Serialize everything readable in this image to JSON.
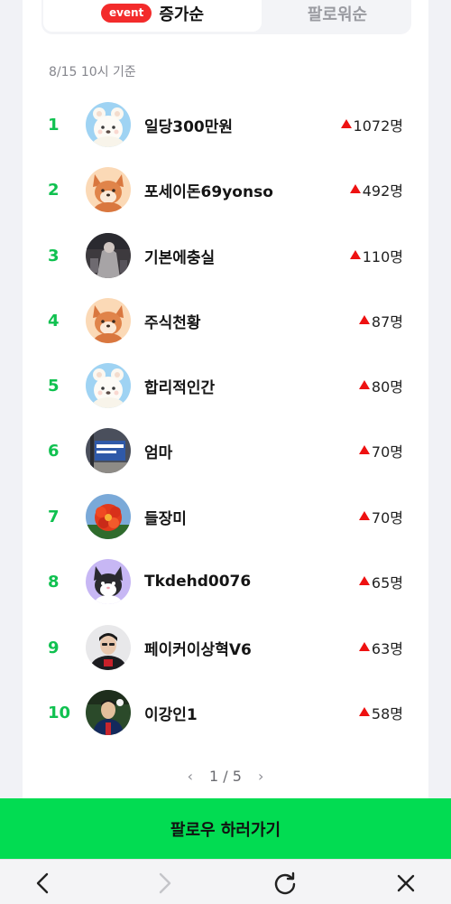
{
  "tabs": {
    "active": {
      "badge": "event",
      "label": "증가순"
    },
    "inactive": {
      "label": "팔로워순"
    }
  },
  "as_of": "8/15 10시 기준",
  "rankings": [
    {
      "rank": "1",
      "name": "일당300만원",
      "change": "1072명",
      "avatar": "bear-white-avatar"
    },
    {
      "rank": "2",
      "name": "포세이돈69yonso",
      "change": "492명",
      "avatar": "fox-avatar"
    },
    {
      "rank": "3",
      "name": "기본에충실",
      "change": "110명",
      "avatar": "photo-avatar"
    },
    {
      "rank": "4",
      "name": "주식천황",
      "change": "87명",
      "avatar": "fox-avatar"
    },
    {
      "rank": "5",
      "name": "합리적인간",
      "change": "80명",
      "avatar": "bear-white-avatar"
    },
    {
      "rank": "6",
      "name": "엄마",
      "change": "70명",
      "avatar": "sign-photo-avatar"
    },
    {
      "rank": "7",
      "name": "들장미",
      "change": "70명",
      "avatar": "flower-avatar"
    },
    {
      "rank": "8",
      "name": "Tkdehd0076",
      "change": "65명",
      "avatar": "cat-avatar"
    },
    {
      "rank": "9",
      "name": "페이커이상혁V6",
      "change": "63명",
      "avatar": "person-avatar"
    },
    {
      "rank": "10",
      "name": "이강인1",
      "change": "58명",
      "avatar": "soccer-avatar"
    }
  ],
  "pagination": {
    "current": "1",
    "separator": "/",
    "total": "5"
  },
  "follow_button": "팔로우 하러가기",
  "navbar": {
    "icons": [
      "back-arrow-icon",
      "forward-arrow-icon",
      "refresh-icon",
      "close-icon"
    ]
  },
  "colors": {
    "accent_green": "#02dc52",
    "rank_green": "#10c150",
    "up_red": "#ee1111",
    "badge_red": "#f32b2b"
  }
}
